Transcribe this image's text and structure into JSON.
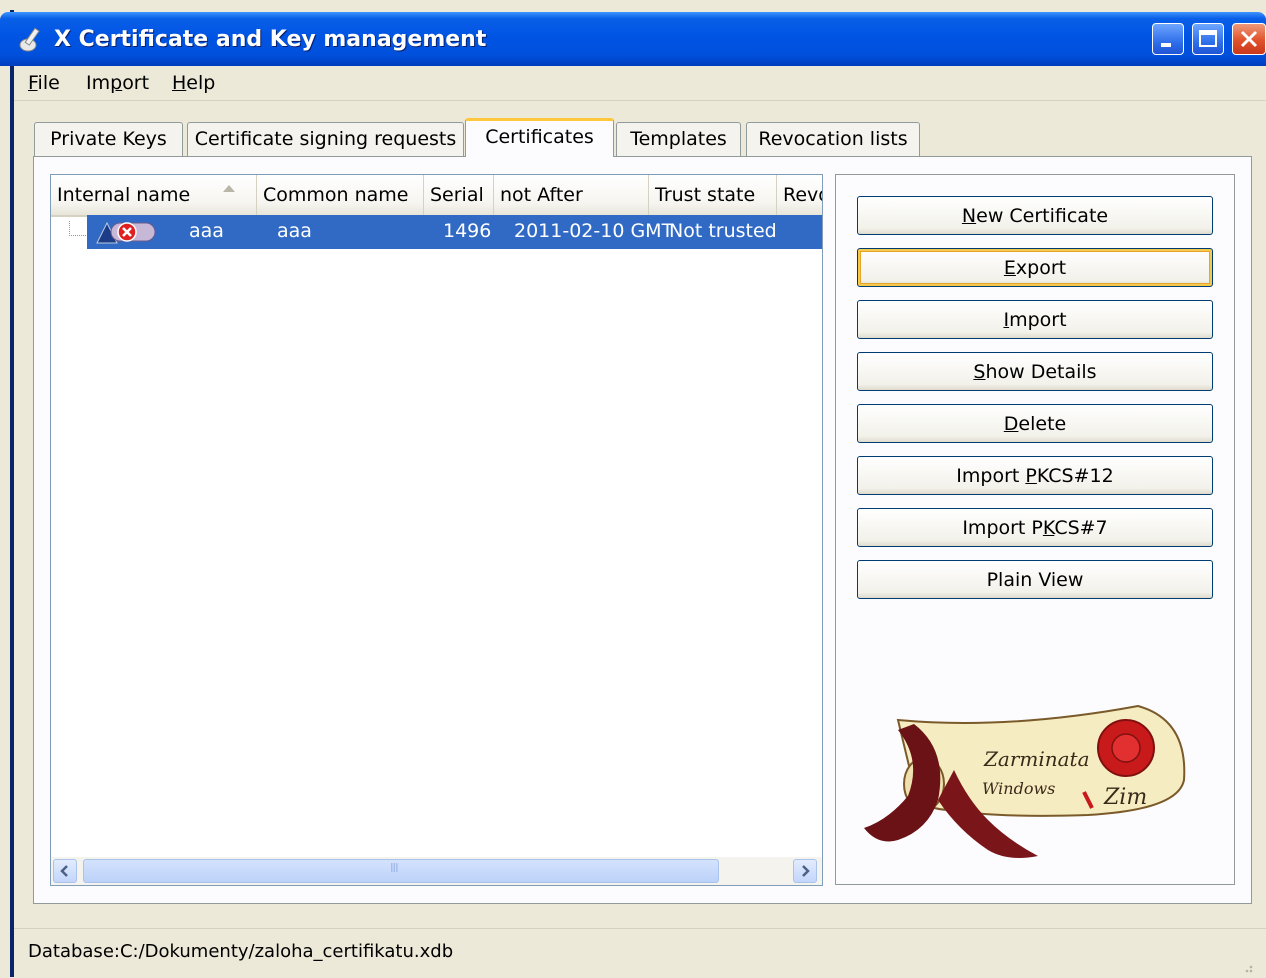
{
  "window": {
    "title": "X Certificate and Key management"
  },
  "menu": {
    "items": [
      {
        "label": "File",
        "mnemonic": "F",
        "rest": "ile"
      },
      {
        "label": "Import",
        "pre": "Im",
        "mnemonic": "p",
        "rest": "ort"
      },
      {
        "label": "Help",
        "mnemonic": "H",
        "rest": "elp"
      }
    ]
  },
  "tabs": [
    {
      "label": "Private Keys",
      "active": false
    },
    {
      "label": "Certificate signing requests",
      "active": false
    },
    {
      "label": "Certificates",
      "active": true
    },
    {
      "label": "Templates",
      "active": false
    },
    {
      "label": "Revocation lists",
      "active": false
    }
  ],
  "table": {
    "columns": [
      "Internal name",
      "Common name",
      "Serial",
      "not After",
      "Trust state",
      "Revo"
    ],
    "sorted_column": "Internal name",
    "rows": [
      {
        "internal_name": "aaa",
        "common_name": "aaa",
        "serial": "1496",
        "not_after": "2011-02-10 GMT",
        "trust_state": "Not trusted",
        "selected": true
      }
    ],
    "scroll_thumb_label": "III"
  },
  "buttons": {
    "new_certificate": {
      "pre": "",
      "u": "N",
      "post": "ew Certificate"
    },
    "export": {
      "pre": "",
      "u": "E",
      "post": "xport"
    },
    "import": {
      "pre": "",
      "u": "I",
      "post": "mport"
    },
    "show_details": {
      "pre": "",
      "u": "S",
      "post": "how Details"
    },
    "delete": {
      "pre": "",
      "u": "D",
      "post": "elete"
    },
    "import_pkcs12": {
      "pre": "Import ",
      "u": "P",
      "post": "KCS#12"
    },
    "import_pkcs7": {
      "pre": "Import P",
      "u": "K",
      "post": "CS#7"
    },
    "plain_view": {
      "pre": "Plain View",
      "u": "",
      "post": ""
    }
  },
  "logo": {
    "text_line1": "Zarminata",
    "text_line2": "Windows",
    "text_line3": "Zim"
  },
  "status": {
    "text": "Database:C:/Dokumenty/zaloha_certifikatu.xdb"
  },
  "colors": {
    "titlebar": "#0054e3",
    "selection": "#316ac5",
    "tab_highlight": "#ffc83c"
  }
}
